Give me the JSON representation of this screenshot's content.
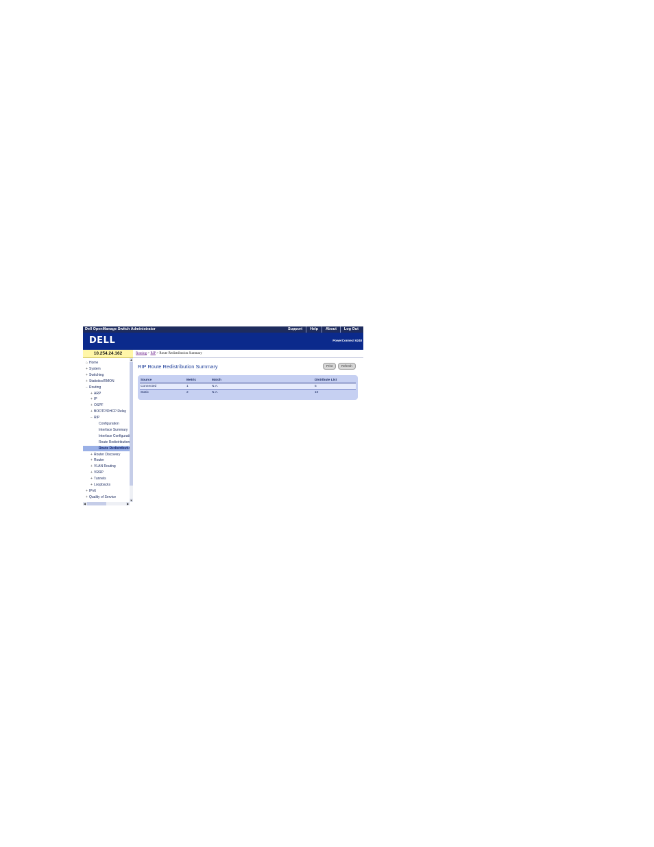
{
  "window": {
    "title": "Dell OpenManage Switch Administrator",
    "links": [
      "Support",
      "Help",
      "About",
      "Log Out"
    ]
  },
  "brand": {
    "logo": "DELL",
    "model": "PowerConnect 6248"
  },
  "device_ip": "10.254.24.162",
  "breadcrumb": {
    "items": [
      "Routing",
      "RIP"
    ],
    "current": "Route Redistribution Summary",
    "separator": ">"
  },
  "tree": [
    {
      "label": "Home",
      "depth": 0,
      "icon": "home-icon"
    },
    {
      "label": "System",
      "depth": 0,
      "icon": "expand-icon"
    },
    {
      "label": "Switching",
      "depth": 0,
      "icon": "expand-icon"
    },
    {
      "label": "Statistics/RMON",
      "depth": 0,
      "icon": "expand-icon"
    },
    {
      "label": "Routing",
      "depth": 0,
      "icon": "collapse-icon"
    },
    {
      "label": "ARP",
      "depth": 1,
      "icon": "expand-icon"
    },
    {
      "label": "IP",
      "depth": 1,
      "icon": "expand-icon"
    },
    {
      "label": "OSPF",
      "depth": 1,
      "icon": "expand-icon"
    },
    {
      "label": "BOOTP/DHCP Relay",
      "depth": 1,
      "icon": "expand-icon"
    },
    {
      "label": "RIP",
      "depth": 1,
      "icon": "collapse-icon"
    },
    {
      "label": "Configuration",
      "depth": 2,
      "icon": ""
    },
    {
      "label": "Interface Summary",
      "depth": 2,
      "icon": ""
    },
    {
      "label": "Interface Configuration",
      "depth": 2,
      "icon": ""
    },
    {
      "label": "Route Redistribution",
      "depth": 2,
      "icon": ""
    },
    {
      "label": "Route Redistribution",
      "depth": 2,
      "icon": "",
      "selected": true
    },
    {
      "label": "Router Discovery",
      "depth": 1,
      "icon": "expand-icon"
    },
    {
      "label": "Router",
      "depth": 1,
      "icon": "expand-icon"
    },
    {
      "label": "VLAN Routing",
      "depth": 1,
      "icon": "expand-icon"
    },
    {
      "label": "VRRP",
      "depth": 1,
      "icon": "expand-icon"
    },
    {
      "label": "Tunnels",
      "depth": 1,
      "icon": "expand-icon"
    },
    {
      "label": "Loopbacks",
      "depth": 1,
      "icon": "expand-icon"
    },
    {
      "label": "IPv6",
      "depth": 0,
      "icon": "expand-icon"
    },
    {
      "label": "Quality of Service",
      "depth": 0,
      "icon": "expand-icon"
    }
  ],
  "page": {
    "title": "RIP Route Redistribution Summary",
    "print_label": "Print",
    "refresh_label": "Refresh"
  },
  "table": {
    "headers": {
      "source": "Source",
      "metric": "Metric",
      "match": "Match",
      "distribute": "Distribute List"
    },
    "rows": [
      {
        "source": "Connected",
        "metric": "1",
        "match": "N.A.",
        "distribute": "5"
      },
      {
        "source": "Static",
        "metric": "2",
        "match": "N.A.",
        "distribute": "10"
      }
    ]
  },
  "colors": {
    "menubar": "#1e2c5e",
    "brand_band": "#0b2a8c",
    "ip_bar": "#fff6a8",
    "title_text": "#1f3f9a",
    "table_panel": "#c6d0f2",
    "tree_selected": "#9ab0e6"
  }
}
